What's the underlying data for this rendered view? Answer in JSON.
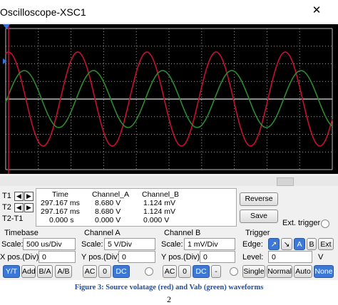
{
  "window": {
    "title": "Oscilloscope-XSC1",
    "close_glyph": "✕"
  },
  "waveforms": {
    "channel_a_color": "#c8102e",
    "channel_b_color": "#2e8b2e",
    "cursor1_color": "#c8102e",
    "cursor2_color": "#3a6fd8",
    "ground_marker_color": "#3a6fd8",
    "channel_a_note": "red sine, source voltage",
    "channel_b_note": "green sine, Vab"
  },
  "cursors": {
    "t1": "T1",
    "t2": "T2",
    "t2t1": "T2-T1",
    "left_glyph": "◀",
    "right_glyph": "▶"
  },
  "readout": {
    "headers": [
      "Time",
      "Channel_A",
      "Channel_B"
    ],
    "rows": [
      [
        "297.167 ms",
        "8.680 V",
        "1.124 mV"
      ],
      [
        "297.167 ms",
        "8.680 V",
        "1.124 mV"
      ],
      [
        "0.000 s",
        "0.000 V",
        "0.000 V"
      ]
    ]
  },
  "buttons": {
    "reverse": "Reverse",
    "save": "Save"
  },
  "ext_trigger": {
    "label": "Ext. trigger"
  },
  "timebase": {
    "title": "Timebase",
    "scale_label": "Scale:",
    "scale_value": "500 us/Div",
    "xpos_label": "X pos.(Div):",
    "xpos_value": "0",
    "modes": [
      "Y/T",
      "Add",
      "B/A",
      "A/B"
    ],
    "active_mode": "Y/T"
  },
  "channel_a": {
    "title": "Channel A",
    "scale_label": "Scale:",
    "scale_value": "5 V/Div",
    "ypos_label": "Y pos.(Div):",
    "ypos_value": "0",
    "coupling": [
      "AC",
      "0",
      "DC"
    ],
    "active_coupling": "DC"
  },
  "channel_b": {
    "title": "Channel B",
    "scale_label": "Scale:",
    "scale_value": "1 mV/Div",
    "ypos_label": "Y pos.(Div):",
    "ypos_value": "0",
    "coupling": [
      "AC",
      "0",
      "DC",
      "-"
    ],
    "active_coupling": "DC"
  },
  "trigger": {
    "title": "Trigger",
    "edge_label": "Edge:",
    "edge_buttons": [
      "↗",
      "↘",
      "A",
      "B",
      "Ext"
    ],
    "active_edge": "A",
    "level_label": "Level:",
    "level_value": "0",
    "level_unit": "V",
    "modes": [
      "Single",
      "Normal",
      "Auto",
      "None"
    ],
    "active_mode": "None"
  },
  "caption": "Figure 3: Source volatage (red) and Vab (green) waveforms",
  "page_number": "2"
}
